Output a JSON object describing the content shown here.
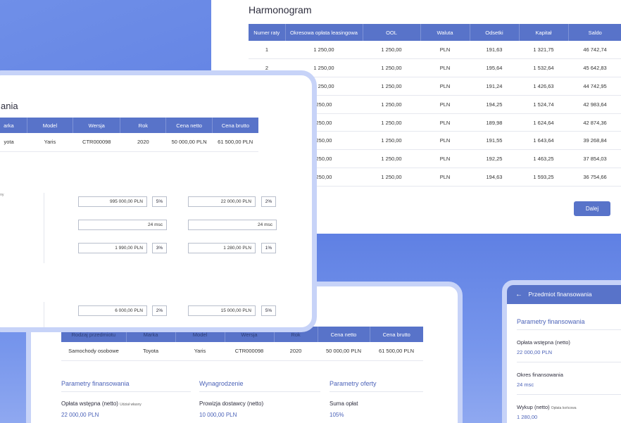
{
  "harmonogram": {
    "title": "Harmonogram",
    "headers": [
      "Numer raty",
      "Okresowa opłata leasingowa",
      "OOL",
      "Waluta",
      "Odsetki",
      "Kapitał",
      "Saldo"
    ],
    "rows": [
      [
        "1",
        "1 250,00",
        "1 250,00",
        "PLN",
        "191,63",
        "1 321,75",
        "46 742,74"
      ],
      [
        "2",
        "1 250,00",
        "1 250,00",
        "PLN",
        "195,64",
        "1 532,64",
        "45 642,83"
      ],
      [
        "",
        "1 250,00",
        "1 250,00",
        "PLN",
        "191,24",
        "1 426,63",
        "44 742,95"
      ],
      [
        "",
        "250,00",
        "1 250,00",
        "PLN",
        "194,25",
        "1 524,74",
        "42 983,64"
      ],
      [
        "",
        "250,00",
        "1 250,00",
        "PLN",
        "189,98",
        "1 624,64",
        "42 874,36"
      ],
      [
        "",
        "250,00",
        "1 250,00",
        "PLN",
        "191,55",
        "1 643,64",
        "39 268,84"
      ],
      [
        "",
        "250,00",
        "1 250,00",
        "PLN",
        "192,25",
        "1 463,25",
        "37 854,03"
      ],
      [
        "",
        "250,00",
        "1 250,00",
        "PLN",
        "194,63",
        "1 593,25",
        "36 754,66"
      ]
    ],
    "next_button": "Dalej"
  },
  "vehicle": {
    "title": "ania",
    "headers": [
      "arka",
      "Model",
      "Wersja",
      "Rok",
      "Cena netto",
      "Cena brutto"
    ],
    "row": [
      "yota",
      "Yaris",
      "CTR000098",
      "2020",
      "50 000,00 PLN",
      "61 500,00 PLN"
    ],
    "tiny_label": "asny",
    "fields": [
      {
        "v1": "995 000,00 PLN",
        "p1": "5%",
        "v2": "22 000,00 PLN",
        "p2": "2%"
      },
      {
        "v1": "24 msc",
        "v2": "24 msc"
      },
      {
        "v1": "1 990,00 PLN",
        "p1": "3%",
        "v2": "1 280,00 PLN",
        "p2": "1%"
      },
      {
        "v1": "6 000,00 PLN",
        "p1": "2%",
        "v2": "15 000,00 PLN",
        "p2": "5%"
      }
    ]
  },
  "offer": {
    "headers": [
      "Rodzaj przedmiotu",
      "Marka",
      "Model",
      "Wersja",
      "Rok",
      "Cena netto",
      "Cena brutto"
    ],
    "row": [
      "Samochody osobowe",
      "Toyota",
      "Yaris",
      "CTR000098",
      "2020",
      "50 000,00 PLN",
      "61 500,00 PLN"
    ],
    "sections": {
      "financing": "Parametry finansowania",
      "commission": "Wynagrodzenie",
      "offer_params": "Parametry oferty"
    },
    "fields": {
      "down_payment_label": "Opłata wstępna (netto)",
      "down_payment_note": "Udział własny",
      "down_payment_value": "22 000,00 PLN",
      "supplier_fee_label": "Prowizja dostawcy (netto)",
      "supplier_fee_value": "10 000,00 PLN",
      "total_label": "Suma opłat",
      "total_value": "105%"
    }
  },
  "mobile": {
    "header": "Przedmiot finansowania",
    "section": "Parametry finansowania",
    "items": [
      {
        "label": "Opłata wstępna (netto)",
        "note": "",
        "value": "22 000,00 PLN"
      },
      {
        "label": "Okres finansowania",
        "note": "",
        "value": "24 msc"
      },
      {
        "label": "Wykup (netto)",
        "note": "Opłata końcowa",
        "value": "1 280,00"
      }
    ]
  },
  "colors": {
    "accent": "#5873c9",
    "background_blue": "#6f8fe8",
    "card_border": "#c7d3f8",
    "link_blue": "#4b62b8"
  }
}
